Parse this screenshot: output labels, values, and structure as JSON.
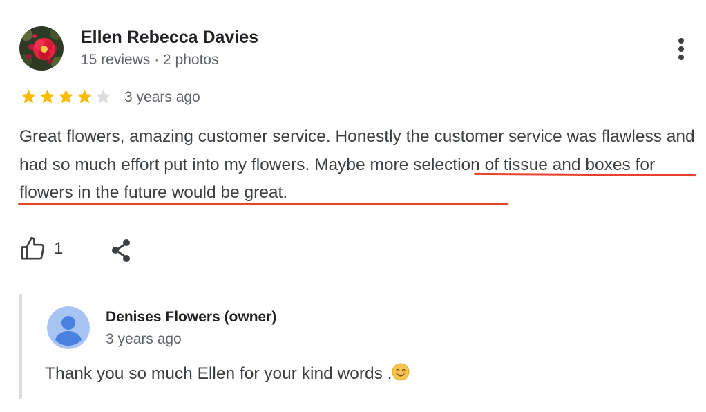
{
  "review": {
    "reviewer_name": "Ellen Rebecca Davies",
    "reviewer_meta": "15 reviews · 2 photos",
    "rating": 4,
    "rating_max": 5,
    "time_ago": "3 years ago",
    "text_part1": "Great flowers, amazing customer service. Honestly the customer service was flawless and had so much effort put into my flowers. ",
    "text_highlight": "Maybe more selection of tissue and boxes for flowers in the future would be great",
    "text_end": ".",
    "like_count": "1"
  },
  "reply": {
    "owner_name": "Denises Flowers (owner)",
    "time_ago": "3 years ago",
    "text": "Thank you so much Ellen for your kind words ."
  },
  "icons": {
    "more": "more-vertical-icon",
    "like": "thumbs-up-icon",
    "share": "share-icon",
    "star_filled": "star-filled-icon",
    "star_empty": "star-empty-icon",
    "emoji": "smiling-face-emoji-icon"
  },
  "colors": {
    "star_filled": "#fbbc04",
    "star_empty": "#dadce0",
    "highlight_underline": "#e8412c",
    "reply_border": "#dadce0",
    "owner_avatar_bg": "#a7c4f2",
    "owner_avatar_fg": "#4a80e0"
  }
}
